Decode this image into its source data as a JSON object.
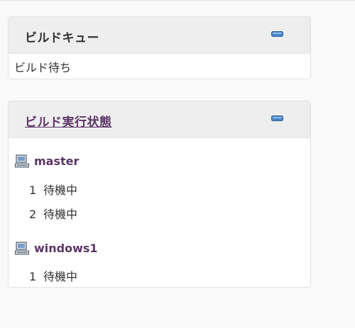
{
  "build_queue": {
    "title": "ビルドキュー",
    "status": "ビルド待ち",
    "collapse_icon": "minus-icon"
  },
  "build_executor": {
    "title": "ビルド実行状態",
    "collapse_icon": "minus-icon",
    "computers": [
      {
        "name": "master",
        "icon": "computer-icon",
        "executors": [
          {
            "number": "1",
            "status": "待機中"
          },
          {
            "number": "2",
            "status": "待機中"
          }
        ]
      },
      {
        "name": "windows1",
        "icon": "computer-icon",
        "executors": [
          {
            "number": "1",
            "status": "待機中"
          }
        ]
      }
    ]
  },
  "colors": {
    "link": "#5c3566",
    "header_bg": "#eeeeee",
    "collapse_icon": "#3a76b8"
  }
}
